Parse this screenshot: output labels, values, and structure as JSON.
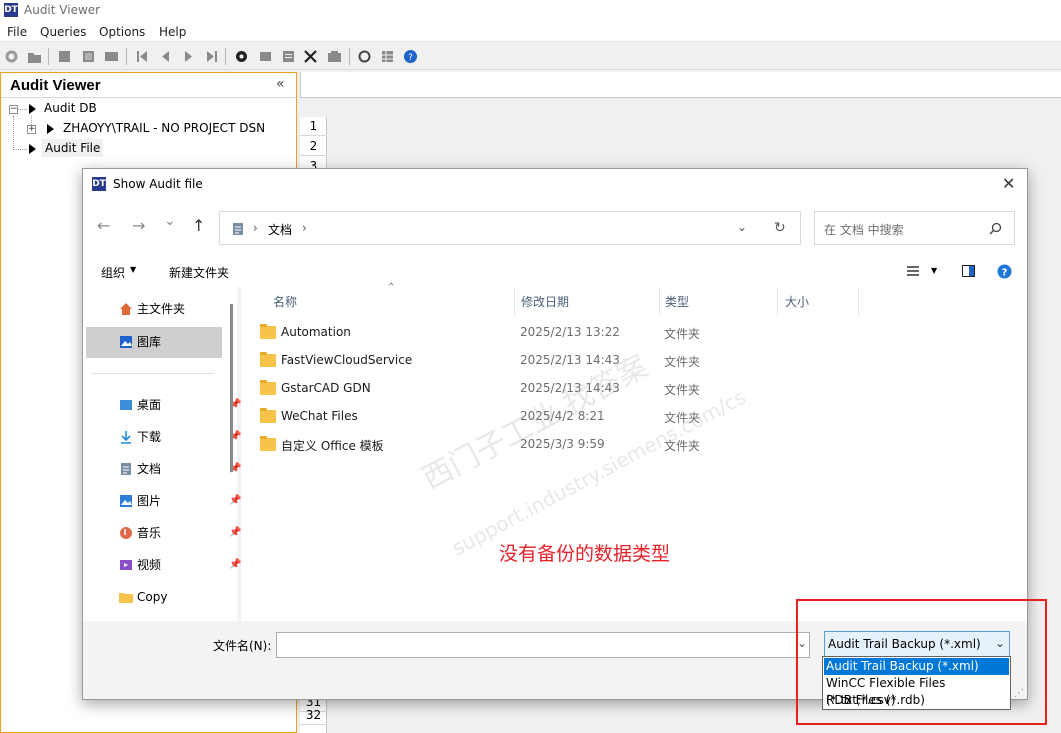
{
  "app": {
    "title": "Audit Viewer",
    "icon_text": "DT"
  },
  "menu": [
    "File",
    "Queries",
    "Options",
    "Help"
  ],
  "toolbar_icons": [
    "new-icon",
    "open-icon",
    "import-icon",
    "export-icon",
    "print-icon",
    "first-icon",
    "prev-icon",
    "next-icon",
    "last-icon",
    "settings-icon",
    "filter-icon",
    "report-icon",
    "tools-icon",
    "archive-icon",
    "refresh-icon",
    "grid-icon",
    "help-icon"
  ],
  "panel": {
    "title": "Audit Viewer",
    "collapse": "«",
    "tree": {
      "db_label": "Audit DB",
      "dsn_label": "ZHAOYY\\TRAIL - NO PROJECT DSN",
      "file_label": "Audit File"
    }
  },
  "grid": {
    "rows_top": [
      "1",
      "2",
      "3"
    ],
    "rows_bottom": [
      "31",
      "32"
    ]
  },
  "dialog": {
    "title": "Show Audit file",
    "close": "✕",
    "nav": {
      "back": "←",
      "forward": "→",
      "dropdown": "⌄",
      "up": "↑"
    },
    "address": {
      "separator": "›",
      "location": "文档",
      "tail": "›"
    },
    "search_placeholder": "在 文档 中搜索",
    "cmd": {
      "organize": "组织",
      "new_folder": "新建文件夹"
    },
    "sidebar": {
      "home": "主文件夹",
      "gallery": "图库",
      "items": [
        {
          "label": "桌面",
          "pinned": true
        },
        {
          "label": "下载",
          "pinned": true
        },
        {
          "label": "文档",
          "pinned": true
        },
        {
          "label": "图片",
          "pinned": true
        },
        {
          "label": "音乐",
          "pinned": true
        },
        {
          "label": "视频",
          "pinned": true
        },
        {
          "label": "Copy",
          "pinned": false
        }
      ]
    },
    "columns": {
      "name": "名称",
      "modified": "修改日期",
      "type": "类型",
      "size": "大小"
    },
    "files": [
      {
        "name": "Automation",
        "date": "2025/2/13 13:22",
        "type": "文件夹"
      },
      {
        "name": "FastViewCloudService",
        "date": "2025/2/13 14:43",
        "type": "文件夹"
      },
      {
        "name": "GstarCAD GDN",
        "date": "2025/2/13 14:43",
        "type": "文件夹"
      },
      {
        "name": "WeChat Files",
        "date": "2025/4/2 8:21",
        "type": "文件夹"
      },
      {
        "name": "自定义 Office 模板",
        "date": "2025/3/3 9:59",
        "type": "文件夹"
      }
    ],
    "annotation": "没有备份的数据类型",
    "filename_label": "文件名(N):",
    "filename_value": "",
    "filetype": {
      "selected": "Audit Trail Backup (*.xml)",
      "options": [
        "Audit Trail Backup (*.xml)",
        "WinCC Flexible Files (*.txt;*.csv)",
        "RDB Files (*.rdb)"
      ]
    },
    "watermark": [
      "西门子工业 找答案",
      "support.industry.siemens.com/cs"
    ]
  },
  "colors": {
    "accent": "#0078d7",
    "annotation": "#e8222a",
    "panel_border": "#f0a020"
  }
}
